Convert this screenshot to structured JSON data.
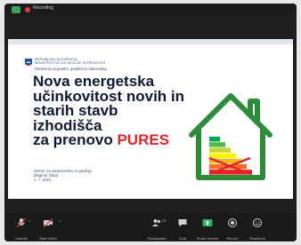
{
  "top_bar": {
    "recording_label": "Recording"
  },
  "slide": {
    "ministry": [
      "REPUBLIKA SLOVENIJA",
      "MINISTRSTVO ZA OKOLJE IN PROSTOR"
    ],
    "directorate": "Direktorat za prostor, graditev in stanovanja",
    "title_lines": [
      "Nova energetska",
      "učinkovitost novih in",
      "starih stavb",
      "izhodišča"
    ],
    "title_last_prefix": "za prenovo ",
    "title_accent": "PURES",
    "sector": "Sektor za ostanovnitvo in gradnjo",
    "author": "Dagmar Šetar",
    "date": "1. 7. 2021"
  },
  "energy_labels": {
    "colors": [
      "#00a651",
      "#50b848",
      "#bfd730",
      "#fff200",
      "#fdb913",
      "#f37021",
      "#ed1c24"
    ],
    "house_color": "#2e8b3a",
    "cross_color": "#e0262b"
  },
  "controls": {
    "items": [
      {
        "label": "Unmute",
        "icon": "microphone-icon"
      },
      {
        "label": "Start Video",
        "icon": "video-camera-icon"
      },
      {
        "label": "Participants",
        "icon": "participants-icon",
        "count": "23"
      },
      {
        "label": "Chat",
        "icon": "chat-icon"
      },
      {
        "label": "Share Screen",
        "icon": "share-screen-icon"
      },
      {
        "label": "Record",
        "icon": "record-icon"
      },
      {
        "label": "Reactions",
        "icon": "reactions-icon"
      }
    ]
  },
  "colors": {
    "share_accent": "#2fb36a",
    "title_accent": "#e0262b",
    "title_text": "#0d1a33"
  }
}
